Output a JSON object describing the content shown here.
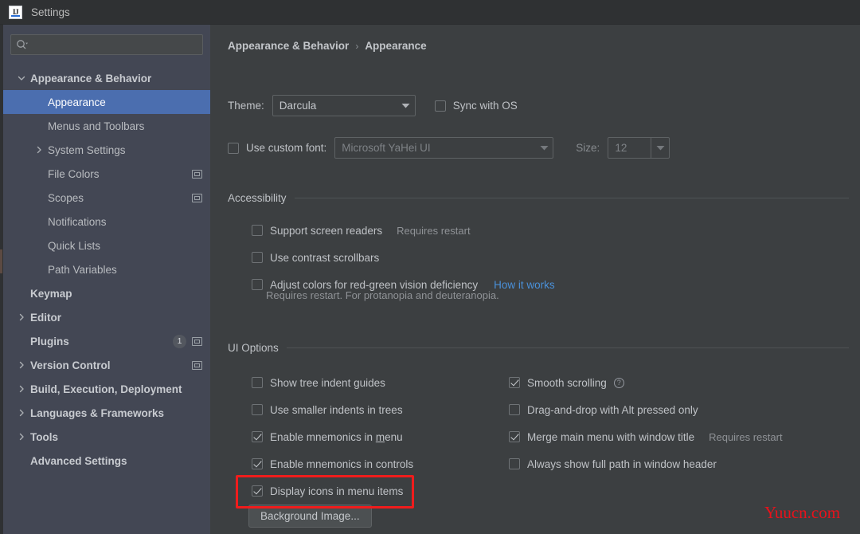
{
  "window": {
    "title": "Settings",
    "logo_icon": "intellij-idea-icon"
  },
  "sidebar": {
    "search": {
      "placeholder": "",
      "value": "",
      "icon": "search-icon"
    },
    "tree": [
      {
        "label": "Appearance & Behavior",
        "level": 0,
        "twisty": "chevron-down",
        "bold": true,
        "selected": false
      },
      {
        "label": "Appearance",
        "level": 1,
        "twisty": "none",
        "bold": false,
        "selected": true
      },
      {
        "label": "Menus and Toolbars",
        "level": 1,
        "twisty": "none",
        "bold": false,
        "selected": false
      },
      {
        "label": "System Settings",
        "level": 1,
        "twisty": "chevron-right",
        "bold": false,
        "selected": false
      },
      {
        "label": "File Colors",
        "level": 1,
        "twisty": "none",
        "bold": false,
        "selected": false,
        "scope_icon": true
      },
      {
        "label": "Scopes",
        "level": 1,
        "twisty": "none",
        "bold": false,
        "selected": false,
        "scope_icon": true
      },
      {
        "label": "Notifications",
        "level": 1,
        "twisty": "none",
        "bold": false,
        "selected": false
      },
      {
        "label": "Quick Lists",
        "level": 1,
        "twisty": "none",
        "bold": false,
        "selected": false
      },
      {
        "label": "Path Variables",
        "level": 1,
        "twisty": "none",
        "bold": false,
        "selected": false
      },
      {
        "label": "Keymap",
        "level": 0,
        "twisty": "none",
        "bold": true,
        "selected": false
      },
      {
        "label": "Editor",
        "level": 0,
        "twisty": "chevron-right",
        "bold": true,
        "selected": false
      },
      {
        "label": "Plugins",
        "level": 0,
        "twisty": "none",
        "bold": true,
        "selected": false,
        "badge": "1",
        "scope_icon": true
      },
      {
        "label": "Version Control",
        "level": 0,
        "twisty": "chevron-right",
        "bold": true,
        "selected": false,
        "scope_icon": true
      },
      {
        "label": "Build, Execution, Deployment",
        "level": 0,
        "twisty": "chevron-right",
        "bold": true,
        "selected": false
      },
      {
        "label": "Languages & Frameworks",
        "level": 0,
        "twisty": "chevron-right",
        "bold": true,
        "selected": false
      },
      {
        "label": "Tools",
        "level": 0,
        "twisty": "chevron-right",
        "bold": true,
        "selected": false
      },
      {
        "label": "Advanced Settings",
        "level": 0,
        "twisty": "none",
        "bold": true,
        "selected": false
      }
    ]
  },
  "main": {
    "breadcrumb": {
      "parent": "Appearance & Behavior",
      "separator": "›",
      "current": "Appearance"
    },
    "theme_row": {
      "label": "Theme:",
      "value": "Darcula",
      "sync_label": "Sync with OS",
      "sync_checked": false
    },
    "font_row": {
      "custom_font_label": "Use custom font:",
      "custom_font_checked": false,
      "font_value": "Microsoft YaHei UI",
      "size_label": "Size:",
      "size_value": "12"
    },
    "accessibility": {
      "title": "Accessibility",
      "items": [
        {
          "label": "Support screen readers",
          "checked": false,
          "hint": "Requires restart"
        },
        {
          "label": "Use contrast scrollbars",
          "checked": false,
          "hint": ""
        },
        {
          "label": "Adjust colors for red-green vision deficiency",
          "checked": false,
          "link": "How it works"
        }
      ],
      "note": "Requires restart. For protanopia and deuteranopia."
    },
    "ui_options": {
      "title": "UI Options",
      "left_column": [
        {
          "label": "Show tree indent guides",
          "checked": false
        },
        {
          "label": "Use smaller indents in trees",
          "checked": false
        },
        {
          "label": "Enable mnemonics in menu",
          "checked": true,
          "mnemonic": "m"
        },
        {
          "label": "Enable mnemonics in controls",
          "checked": true
        },
        {
          "label": "Display icons in menu items",
          "checked": true
        }
      ],
      "right_column": [
        {
          "label": "Smooth scrolling",
          "checked": true,
          "help": true
        },
        {
          "label": "Drag-and-drop with Alt pressed only",
          "checked": false
        },
        {
          "label": "Merge main menu with window title",
          "checked": true,
          "hint": "Requires restart"
        },
        {
          "label": "Always show full path in window header",
          "checked": false
        }
      ],
      "background_image_button": "Background Image..."
    },
    "watermark": "Yuucn.com",
    "annotation_color": "#f01c1c"
  }
}
